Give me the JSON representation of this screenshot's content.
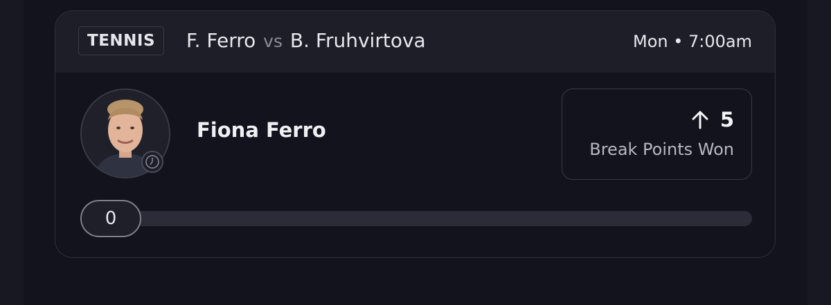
{
  "match": {
    "sport": "TENNIS",
    "player_a": "F. Ferro",
    "vs": "vs",
    "player_b": "B. Fruhvirtova",
    "time": "Mon • 7:00am"
  },
  "player": {
    "name": "Fiona Ferro",
    "avatar_icon": "player-photo",
    "status_icon": "clock-icon"
  },
  "stat": {
    "direction_icon": "arrow-up-icon",
    "value": "5",
    "label": "Break Points Won"
  },
  "progress": {
    "current_label": "0",
    "current": 0,
    "target": 5
  },
  "colors": {
    "background": "#12131c",
    "card_header": "#1d1e28",
    "border": "#3a3b46",
    "text": "#f0f0f4",
    "muted": "#8c8d99",
    "track": "#2b2c37"
  }
}
